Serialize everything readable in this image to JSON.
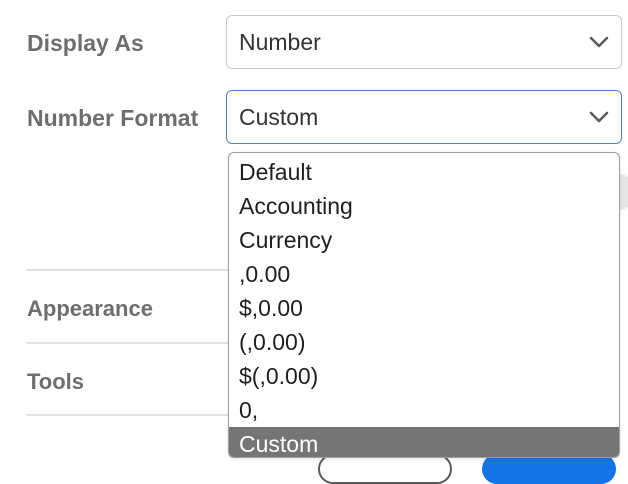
{
  "display_as": {
    "label": "Display As",
    "value": "Number"
  },
  "number_format": {
    "label": "Number Format",
    "value": "Custom",
    "options": [
      "Default",
      "Accounting",
      "Currency",
      ",0.00",
      "$,0.00",
      "(,0.00)",
      "$(,0.00)",
      "0,",
      "Custom"
    ],
    "selected_index": 8
  },
  "sections": {
    "appearance": "Appearance",
    "tools": "Tools"
  },
  "colors": {
    "focus_border": "#4a86c6",
    "selected_option_bg": "#757575",
    "label_text": "#6e6e6e",
    "primary_button": "#1473e6"
  }
}
